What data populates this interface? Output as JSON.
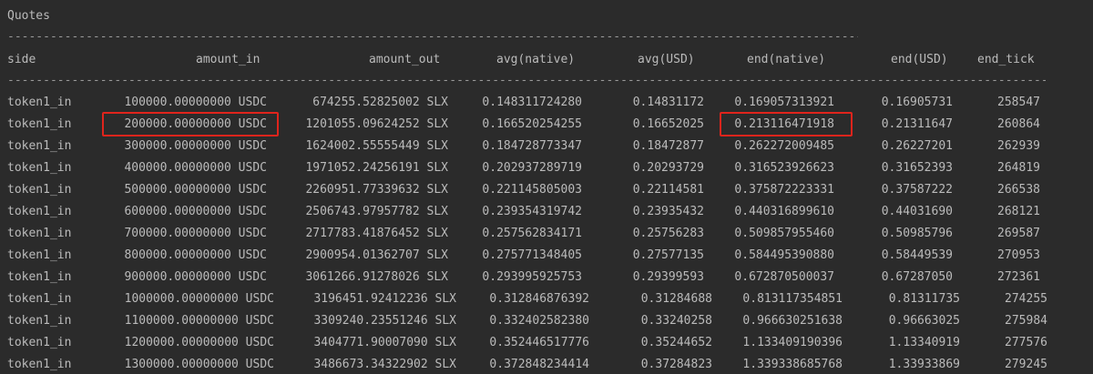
{
  "title": "Quotes",
  "headers": {
    "side": "side",
    "amount_in": "amount_in",
    "amount_out": "amount_out",
    "avg_native": "avg(native)",
    "avg_usd": "avg(USD)",
    "end_native": "end(native)",
    "end_usd": "end(USD)",
    "end_tick": "end_tick"
  },
  "rows": [
    {
      "side": "token1_in",
      "amount_in": "100000.00000000 USDC",
      "amount_out": "674255.52825002 SLX",
      "avg_native": "0.148311724280",
      "avg_usd": "0.14831172",
      "end_native": "0.169057313921",
      "end_usd": "0.16905731",
      "end_tick": "258547"
    },
    {
      "side": "token1_in",
      "amount_in": "200000.00000000 USDC",
      "amount_out": "1201055.09624252 SLX",
      "avg_native": "0.166520254255",
      "avg_usd": "0.16652025",
      "end_native": "0.213116471918",
      "end_usd": "0.21311647",
      "end_tick": "260864"
    },
    {
      "side": "token1_in",
      "amount_in": "300000.00000000 USDC",
      "amount_out": "1624002.55555449 SLX",
      "avg_native": "0.184728773347",
      "avg_usd": "0.18472877",
      "end_native": "0.262272009485",
      "end_usd": "0.26227201",
      "end_tick": "262939"
    },
    {
      "side": "token1_in",
      "amount_in": "400000.00000000 USDC",
      "amount_out": "1971052.24256191 SLX",
      "avg_native": "0.202937289719",
      "avg_usd": "0.20293729",
      "end_native": "0.316523926623",
      "end_usd": "0.31652393",
      "end_tick": "264819"
    },
    {
      "side": "token1_in",
      "amount_in": "500000.00000000 USDC",
      "amount_out": "2260951.77339632 SLX",
      "avg_native": "0.221145805003",
      "avg_usd": "0.22114581",
      "end_native": "0.375872223331",
      "end_usd": "0.37587222",
      "end_tick": "266538"
    },
    {
      "side": "token1_in",
      "amount_in": "600000.00000000 USDC",
      "amount_out": "2506743.97957782 SLX",
      "avg_native": "0.239354319742",
      "avg_usd": "0.23935432",
      "end_native": "0.440316899610",
      "end_usd": "0.44031690",
      "end_tick": "268121"
    },
    {
      "side": "token1_in",
      "amount_in": "700000.00000000 USDC",
      "amount_out": "2717783.41876452 SLX",
      "avg_native": "0.257562834171",
      "avg_usd": "0.25756283",
      "end_native": "0.509857955460",
      "end_usd": "0.50985796",
      "end_tick": "269587"
    },
    {
      "side": "token1_in",
      "amount_in": "800000.00000000 USDC",
      "amount_out": "2900954.01362707 SLX",
      "avg_native": "0.275771348405",
      "avg_usd": "0.27577135",
      "end_native": "0.584495390880",
      "end_usd": "0.58449539",
      "end_tick": "270953"
    },
    {
      "side": "token1_in",
      "amount_in": "900000.00000000 USDC",
      "amount_out": "3061266.91278026 SLX",
      "avg_native": "0.293995925753",
      "avg_usd": "0.29399593",
      "end_native": "0.672870500037",
      "end_usd": "0.67287050",
      "end_tick": "272361"
    },
    {
      "side": "token1_in",
      "amount_in": "1000000.00000000 USDC",
      "amount_out": "3196451.92412236 SLX",
      "avg_native": "0.312846876392",
      "avg_usd": "0.31284688",
      "end_native": "0.813117354851",
      "end_usd": "0.81311735",
      "end_tick": "274255"
    },
    {
      "side": "token1_in",
      "amount_in": "1100000.00000000 USDC",
      "amount_out": "3309240.23551246 SLX",
      "avg_native": "0.332402582380",
      "avg_usd": "0.33240258",
      "end_native": "0.966630251638",
      "end_usd": "0.96663025",
      "end_tick": "275984"
    },
    {
      "side": "token1_in",
      "amount_in": "1200000.00000000 USDC",
      "amount_out": "3404771.90007090 SLX",
      "avg_native": "0.352446517776",
      "avg_usd": "0.35244652",
      "end_native": "1.133409190396",
      "end_usd": "1.13340919",
      "end_tick": "277576"
    },
    {
      "side": "token1_in",
      "amount_in": "1300000.00000000 USDC",
      "amount_out": "3486673.34322902 SLX",
      "avg_native": "0.372848234414",
      "avg_usd": "0.37284823",
      "end_native": "1.339338685768",
      "end_usd": "1.33933869",
      "end_tick": "279245"
    }
  ],
  "colors": {
    "background": "#2b2b2b",
    "text": "#bbbbbb",
    "highlight": "#e0241c"
  }
}
